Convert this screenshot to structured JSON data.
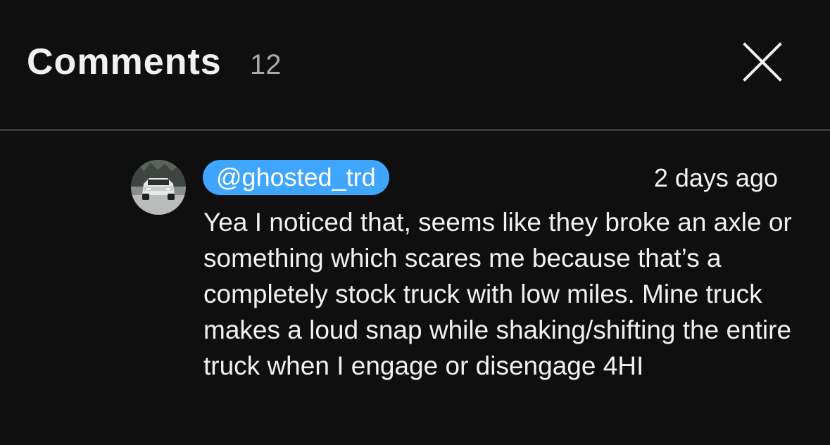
{
  "header": {
    "title": "Comments",
    "count": "12",
    "close_icon": "close-icon"
  },
  "comment": {
    "author": "@ghosted_trd",
    "timestamp": "2 days ago",
    "avatar_icon": "avatar-truck-photo",
    "text": "Yea I noticed that, seems like they broke an axle or something which scares me because that’s a completely stock truck with low miles. Mine truck makes a loud snap while shaking/shifting the entire truck when I engage or disengage 4HI"
  },
  "colors": {
    "background": "#0f0f0f",
    "divider": "#3a3a3a",
    "author_chip": "#3ea6ff",
    "text_primary": "#f1f1f1",
    "text_secondary": "#aaaaaa"
  }
}
